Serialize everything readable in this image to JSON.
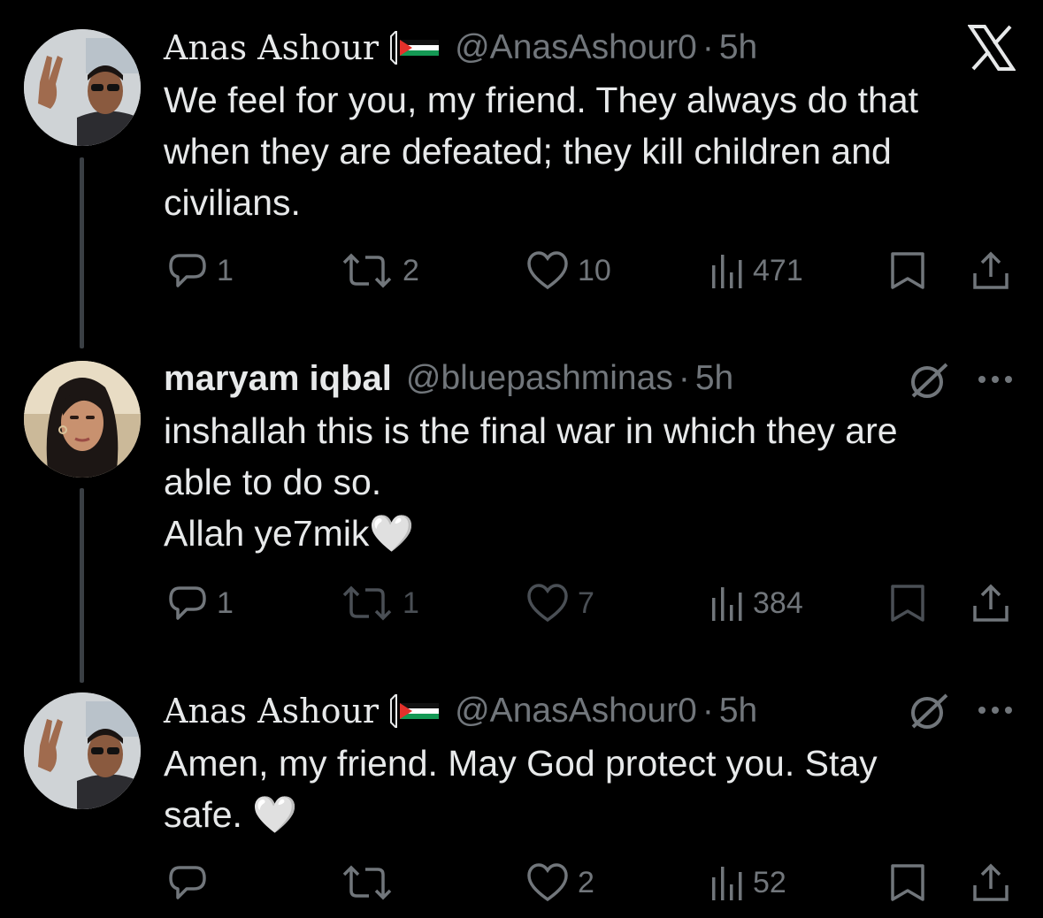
{
  "tweets": [
    {
      "name": "Anas Ashour",
      "handle": "@AnasAshour0",
      "time": "5h",
      "lines": [
        "We feel for you, my friend. They always do that",
        "when they are defeated; they kill children and",
        "civilians."
      ],
      "replies": "1",
      "reposts": "2",
      "likes": "10",
      "views": "471"
    },
    {
      "name": "maryam iqbal",
      "handle": "@bluepashminas",
      "time": "5h",
      "lines": [
        "inshallah this is the final war in which they are",
        "able to do so.",
        "Allah ye7mik🤍"
      ],
      "replies": "1",
      "reposts": "1",
      "likes": "7",
      "views": "384"
    },
    {
      "name": "Anas Ashour",
      "handle": "@AnasAshour0",
      "time": "5h",
      "lines": [
        "Amen, my friend. May God protect you. Stay",
        "safe. 🤍"
      ],
      "replies": "",
      "reposts": "",
      "likes": "2",
      "views": "52"
    }
  ],
  "separator": "·",
  "colors": {
    "background": "#000000",
    "text": "#e7e9ea",
    "muted": "#71767b",
    "thread_line": "#3a3f44"
  },
  "icons": [
    "x-logo-icon",
    "grok-icon",
    "more-icon",
    "reply-icon",
    "repost-icon",
    "like-icon",
    "views-icon",
    "bookmark-icon",
    "share-icon",
    "palestine-flag-icon"
  ]
}
